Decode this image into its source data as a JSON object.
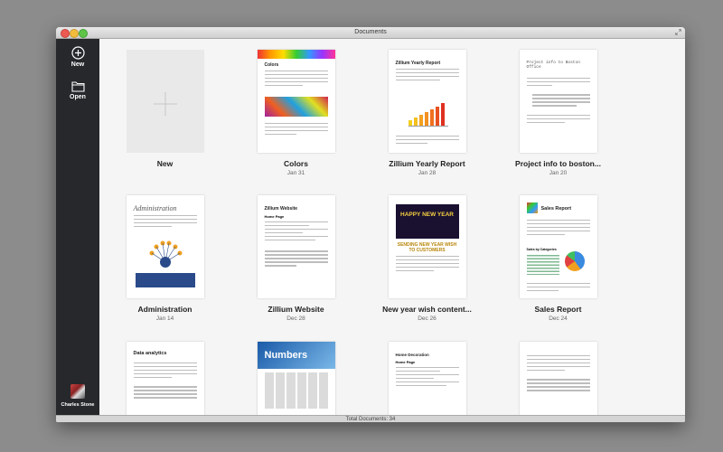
{
  "window": {
    "title": "Documents"
  },
  "sidebar": {
    "new_label": "New",
    "open_label": "Open",
    "user_name": "Charles Stone"
  },
  "documents": [
    {
      "name": "New",
      "date": ""
    },
    {
      "name": "Colors",
      "date": "Jan 31",
      "heading": "Colors"
    },
    {
      "name": "Zillium Yearly Report",
      "date": "Jan 28",
      "heading": "Zillium Yearly Report"
    },
    {
      "name": "Project info to boston...",
      "date": "Jan 20",
      "heading": "Project info to Boston Office"
    },
    {
      "name": "Administration",
      "date": "Jan 14",
      "heading": "Administration"
    },
    {
      "name": "Zillium Website",
      "date": "Dec 28",
      "heading": "Zillium Website",
      "subheading": "Home Page"
    },
    {
      "name": "New year wish content...",
      "date": "Dec 26",
      "banner": "HAPPY NEW YEAR",
      "heading": "SENDING NEW YEAR WISH TO CUSTOMERS"
    },
    {
      "name": "Sales Report",
      "date": "Dec 24",
      "heading": "Sales Report",
      "subheading": "Sales by Categories"
    },
    {
      "name": "",
      "date": "",
      "heading": "Data analytics"
    },
    {
      "name": "",
      "date": "",
      "heading": "Numbers"
    },
    {
      "name": "",
      "date": "",
      "heading": "Home Decoration",
      "subheading": "Home Page"
    },
    {
      "name": "",
      "date": ""
    }
  ],
  "status": {
    "total_documents": "Total Documents: 34"
  },
  "colors": {
    "sidebar": "#26282b",
    "background": "#f5f5f5",
    "accent_orange": "#f0a020"
  }
}
